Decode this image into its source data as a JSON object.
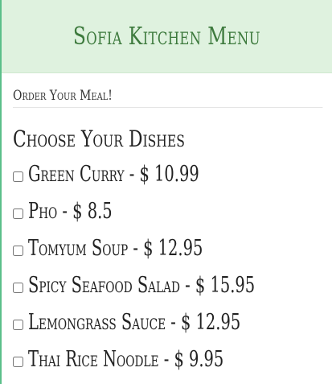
{
  "header": {
    "title": "Sofia Kitchen Menu"
  },
  "form": {
    "order_label": "Order Your Meal!",
    "section_title": "Choose Your Dishes",
    "dishes": [
      {
        "label": "Green Curry - $ 10.99",
        "checked": false
      },
      {
        "label": "Pho - $ 8.5",
        "checked": false
      },
      {
        "label": "Tomyum Soup - $ 12.95",
        "checked": false
      },
      {
        "label": "Spicy Seafood Salad - $ 15.95",
        "checked": false
      },
      {
        "label": "Lemongrass Sauce - $ 12.95",
        "checked": false
      },
      {
        "label": "Thai Rice Noodle - $ 9.95",
        "checked": false
      }
    ]
  },
  "colors": {
    "header_bg": "#dff2df",
    "header_text": "#3d7a3d",
    "left_accent": "#5bbf8a"
  }
}
